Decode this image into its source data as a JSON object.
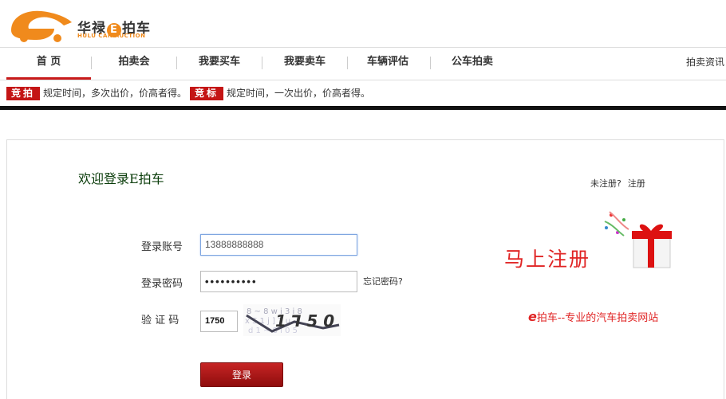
{
  "brand": {
    "name_a": "华禄",
    "name_e": "E",
    "name_b": "拍车",
    "subtitle": "HULU CAR AUCTION",
    "logo_letter": "e"
  },
  "nav": {
    "items": [
      "首 页",
      "拍卖会",
      "我要买车",
      "我要卖车",
      "车辆评估",
      "公车拍卖"
    ],
    "right": "拍卖资讯"
  },
  "notice": {
    "tag1": "竞拍",
    "text1": "规定时间，多次出价，价高者得。",
    "tag2": "竞标",
    "text2": "规定时间，一次出价，价高者得。"
  },
  "login": {
    "welcome": "欢迎登录E拍车",
    "not_registered": "未注册?",
    "register_link": "注册",
    "account_label": "登录账号",
    "account_value": "13888888888",
    "password_label": "登录密码",
    "password_value": "••••••••••",
    "forgot": "忘记密码?",
    "captcha_label": "验 证 码",
    "captcha_value": "1750",
    "submit": "登录"
  },
  "promo": {
    "register_now": "马上注册",
    "slogan_e": "e",
    "slogan_text": "拍车--专业的汽车拍卖网站"
  },
  "colors": {
    "accent": "#c81b1b",
    "logo_orange": "#f08a1c",
    "promo_red": "#e02424"
  }
}
